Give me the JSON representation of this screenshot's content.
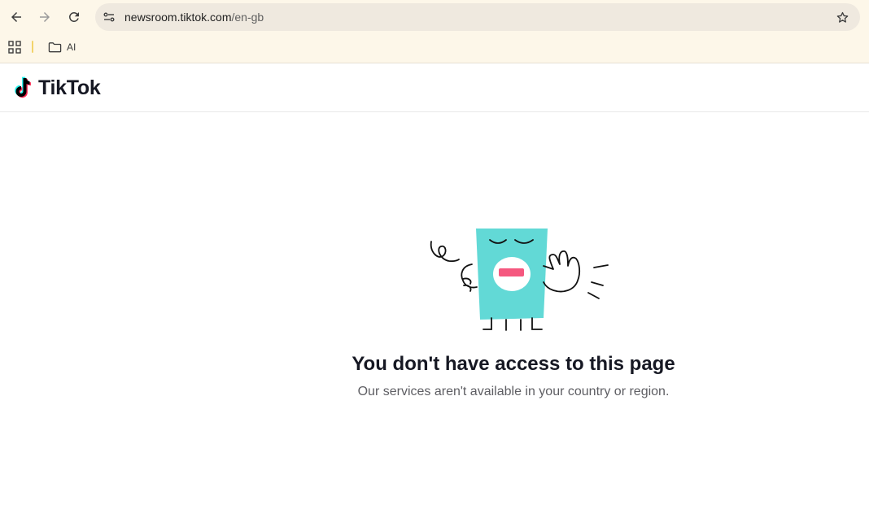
{
  "browser": {
    "url_host": "newsroom.tiktok.com",
    "url_path": "/en-gb",
    "bookmarks": [
      {
        "label": "AI"
      }
    ],
    "icons": [
      "back-arrow-icon",
      "forward-arrow-icon",
      "reload-icon",
      "site-info-icon",
      "star-icon",
      "apps-grid-icon",
      "folder-icon"
    ]
  },
  "header": {
    "logo_text": "TikTok"
  },
  "error": {
    "title": "You don't have access to this page",
    "subtitle": "Our services aren't available in your country or region."
  },
  "colors": {
    "browser_bg": "#fdf7e9",
    "omnibox_bg": "#efe9df",
    "tiktok_cyan": "#25f4ee",
    "tiktok_red": "#fe2c55",
    "illustration_body": "#62d9d6",
    "illustration_mouth": "#f5587f"
  }
}
